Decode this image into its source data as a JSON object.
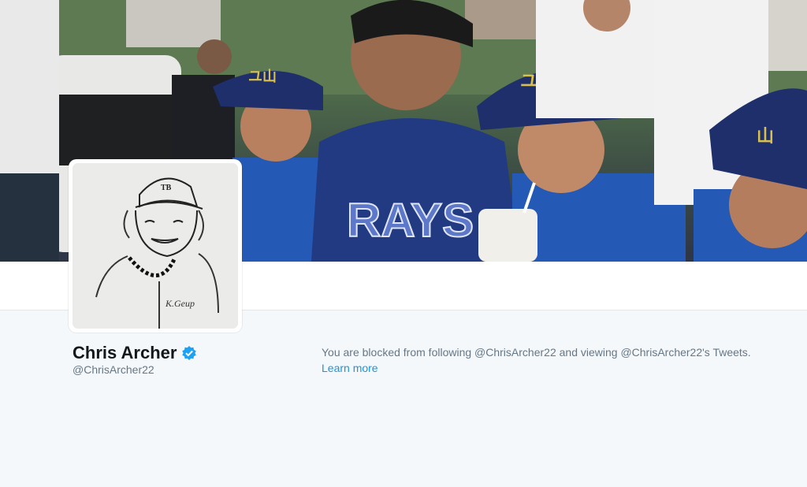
{
  "header": {
    "image_description_icon": "header-photo-icon"
  },
  "profile": {
    "name": "Chris Archer",
    "screen_name": "@ChrisArcher22",
    "verified": true,
    "verified_icon": "verified-badge-icon",
    "avatar_icon": "avatar-sketch-icon"
  },
  "blocked": {
    "message": "You are blocked from following @ChrisArcher22 and viewing @ChrisArcher22's Tweets.",
    "learn_more_label": "Learn more"
  },
  "colors": {
    "background": "#f5f8fa",
    "name": "#14171a",
    "secondary_text": "#657786",
    "link": "#1b95e0",
    "verified": "#1da1f2"
  }
}
